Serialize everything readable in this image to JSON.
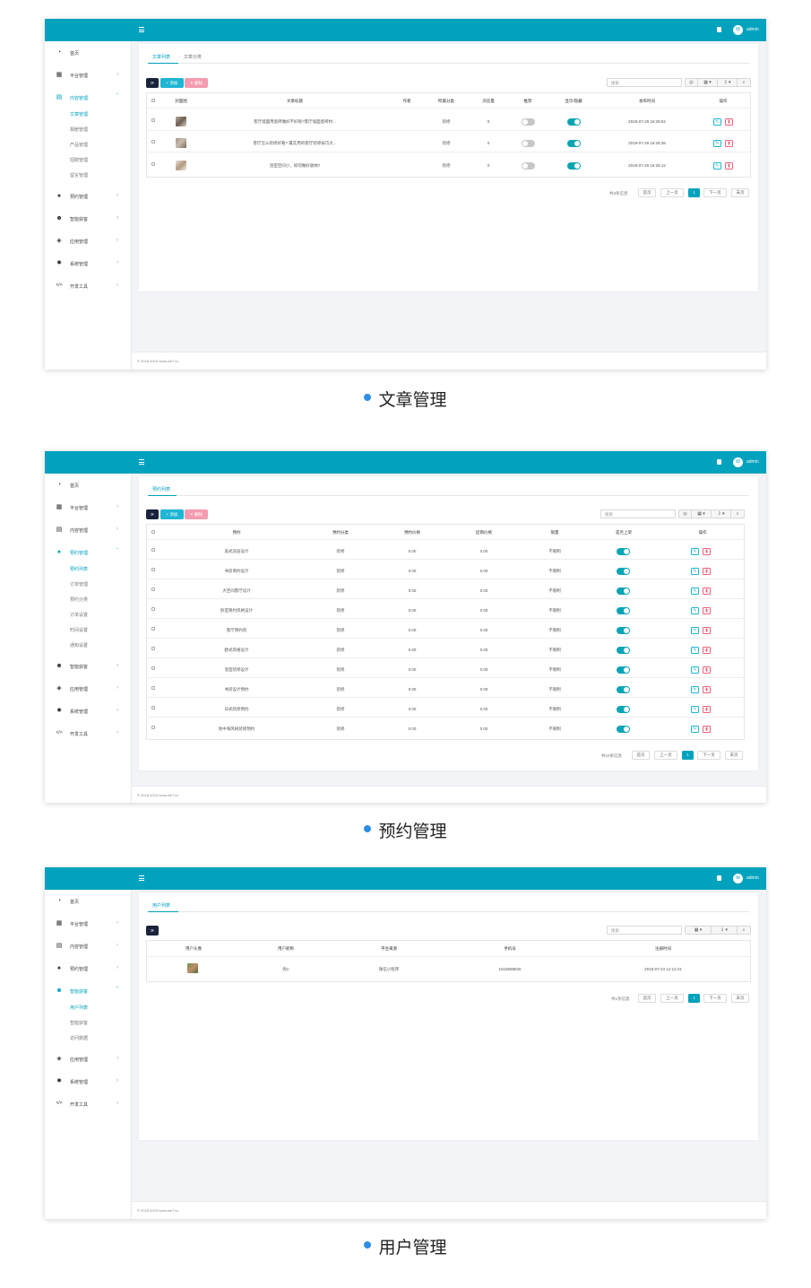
{
  "common": {
    "username": "admin",
    "avatar_letter": "W",
    "footer": "© 2018-2015 www.we7.cc",
    "search_placeholder": "搜索",
    "pager": {
      "first": "首页",
      "prev": "上一页",
      "current": "1",
      "next": "下一页",
      "last": "末页"
    }
  },
  "panel1": {
    "caption": "文章管理",
    "sidebar": {
      "items": [
        {
          "label": "首页"
        },
        {
          "label": "平台管理"
        },
        {
          "label": "内容管理"
        },
        {
          "label": "预约管理"
        },
        {
          "label": "智能获客"
        },
        {
          "label": "应用管理"
        },
        {
          "label": "系统管理"
        },
        {
          "label": "开发工具"
        }
      ],
      "subitems": [
        "文章管理",
        "相册管理",
        "产品管理",
        "招聘管理",
        "留言管理"
      ]
    },
    "tabs": [
      "文章列表",
      "文章分类"
    ],
    "buttons": {
      "add": "+ 添加",
      "delete": "✕ 删除"
    },
    "columns": [
      "封面图",
      "文章标题",
      "作者",
      "所属分类",
      "浏览量",
      "推荐",
      "显示/隐藏",
      "发布时间",
      "操作"
    ],
    "rows": [
      {
        "title": "客厅墙面用瓷砖做好不好呢?客厅墙面瓷砖材...",
        "author": "",
        "category": "装修",
        "views": "0",
        "recommend": false,
        "visible": true,
        "date": "2019-07-29 16:28:52"
      },
      {
        "title": "客厅怎么装修好看? 最实用的客厅装修技巧大...",
        "author": "",
        "category": "装修",
        "views": "0",
        "recommend": false,
        "visible": true,
        "date": "2019-07-29 16:28:36"
      },
      {
        "title": "浴室空间小，如何做好收纳?",
        "author": "",
        "category": "装修",
        "views": "0",
        "recommend": false,
        "visible": true,
        "date": "2019-07-29 16:28:12"
      }
    ],
    "pager_info": "共3条信息"
  },
  "panel2": {
    "caption": "预约管理",
    "sidebar": {
      "items": [
        {
          "label": "首页"
        },
        {
          "label": "平台管理"
        },
        {
          "label": "内容管理"
        },
        {
          "label": "预约管理"
        },
        {
          "label": "智能获客"
        },
        {
          "label": "应用管理"
        },
        {
          "label": "系统管理"
        },
        {
          "label": "开发工具"
        }
      ],
      "subitems": [
        "预约列表",
        "订单管理",
        "预约分类",
        "订单设置",
        "时间设置",
        "通知设置"
      ]
    },
    "tabs": [
      "预约列表"
    ],
    "buttons": {
      "add": "+ 添加",
      "delete": "✕ 删除"
    },
    "columns": [
      "预约",
      "预约分类",
      "预约价格",
      "促销价格",
      "限量",
      "是否上架",
      "操作"
    ],
    "rows": [
      {
        "name": "美式双层设计",
        "category": "装修",
        "price": "0.00",
        "promo": "0.00",
        "limit": "不限制",
        "on": true
      },
      {
        "name": "书房简约设计",
        "category": "装修",
        "price": "0.00",
        "promo": "0.00",
        "limit": "不限制",
        "on": true
      },
      {
        "name": "大空间客厅设计",
        "category": "装修",
        "price": "0.00",
        "promo": "0.00",
        "limit": "不限制",
        "on": true
      },
      {
        "name": "卧室简约风格设计",
        "category": "装修",
        "price": "0.00",
        "promo": "0.00",
        "limit": "不限制",
        "on": true
      },
      {
        "name": "客厅简约风",
        "category": "装修",
        "price": "0.00",
        "promo": "0.00",
        "limit": "不限制",
        "on": true
      },
      {
        "name": "欧式风格设计",
        "category": "装修",
        "price": "0.00",
        "promo": "0.00",
        "limit": "不限制",
        "on": true
      },
      {
        "name": "浴室装修设计",
        "category": "装修",
        "price": "0.00",
        "promo": "0.00",
        "limit": "不限制",
        "on": true
      },
      {
        "name": "书房设计预约",
        "category": "装修",
        "price": "0.00",
        "promo": "0.00",
        "limit": "不限制",
        "on": true
      },
      {
        "name": "日式装修预约",
        "category": "装修",
        "price": "0.00",
        "promo": "0.00",
        "limit": "不限制",
        "on": true
      },
      {
        "name": "地中海风格装修预约",
        "category": "装修",
        "price": "0.00",
        "promo": "0.00",
        "limit": "不限制",
        "on": true
      }
    ],
    "pager_info": "共10条信息"
  },
  "panel3": {
    "caption": "用户管理",
    "sidebar": {
      "items": [
        {
          "label": "首页"
        },
        {
          "label": "平台管理"
        },
        {
          "label": "内容管理"
        },
        {
          "label": "预约管理"
        },
        {
          "label": "智能获客"
        },
        {
          "label": "应用管理"
        },
        {
          "label": "系统管理"
        },
        {
          "label": "开发工具"
        }
      ],
      "subitems": [
        "用户列表",
        "智能获客",
        "访问数据"
      ]
    },
    "tabs": [
      "用户列表"
    ],
    "columns": [
      "用户头像",
      "用户昵称",
      "平台来源",
      "手机号",
      "注册时间"
    ],
    "rows": [
      {
        "nickname": "优C",
        "source": "微信小程序",
        "phone": "1518698840",
        "date": "2019-07-24 12:12:41"
      }
    ],
    "pager_info": "共1条信息"
  }
}
